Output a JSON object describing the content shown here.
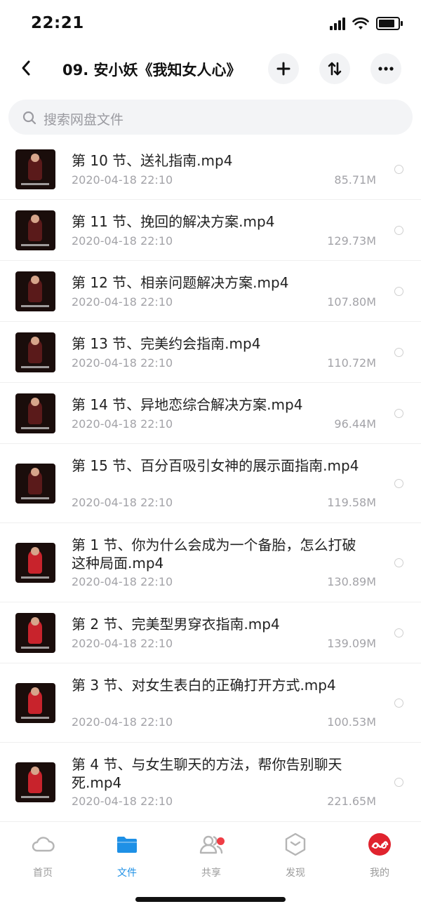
{
  "status_bar": {
    "time": "22:21"
  },
  "header": {
    "title": "09. 安小妖《我知女人心》"
  },
  "search": {
    "placeholder": "搜索网盘文件"
  },
  "files": [
    {
      "name": "第 10 节、送礼指南.mp4",
      "date": "2020-04-18 22:10",
      "size": "85.71M",
      "shirt": "#5a1a1a"
    },
    {
      "name": "第 11 节、挽回的解决方案.mp4",
      "date": "2020-04-18 22:10",
      "size": "129.73M",
      "shirt": "#5a1a1a"
    },
    {
      "name": "第 12 节、相亲问题解决方案.mp4",
      "date": "2020-04-18 22:10",
      "size": "107.80M",
      "shirt": "#5a1a1a"
    },
    {
      "name": "第 13 节、完美约会指南.mp4",
      "date": "2020-04-18 22:10",
      "size": "110.72M",
      "shirt": "#5a1a1a"
    },
    {
      "name": "第 14 节、异地恋综合解决方案.mp4",
      "date": "2020-04-18 22:10",
      "size": "96.44M",
      "shirt": "#5a1a1a"
    },
    {
      "name": "第 15 节、百分百吸引女神的展示面指南.mp4",
      "date": "2020-04-18 22:10",
      "size": "119.58M",
      "shirt": "#5a1a1a"
    },
    {
      "name": "第 1 节、你为什么会成为一个备胎，怎么打破这种局面.mp4",
      "date": "2020-04-18 22:10",
      "size": "130.89M",
      "shirt": "#c8232c"
    },
    {
      "name": "第 2 节、完美型男穿衣指南.mp4",
      "date": "2020-04-18 22:10",
      "size": "139.09M",
      "shirt": "#c8232c"
    },
    {
      "name": "第 3 节、对女生表白的正确打开方式.mp4",
      "date": "2020-04-18 22:10",
      "size": "100.53M",
      "shirt": "#c8232c"
    },
    {
      "name": "第 4 节、与女生聊天的方法，帮你告别聊天死.mp4",
      "date": "2020-04-18 22:10",
      "size": "221.65M",
      "shirt": "#c8232c"
    }
  ],
  "tabs": [
    {
      "label": "首页",
      "icon": "cloud-icon"
    },
    {
      "label": "文件",
      "icon": "folder-icon"
    },
    {
      "label": "共享",
      "icon": "people-icon"
    },
    {
      "label": "发现",
      "icon": "discover-icon"
    },
    {
      "label": "我的",
      "icon": "avatar-icon"
    }
  ],
  "colors": {
    "accent": "#1e90e6",
    "badge": "#ef3d45"
  }
}
